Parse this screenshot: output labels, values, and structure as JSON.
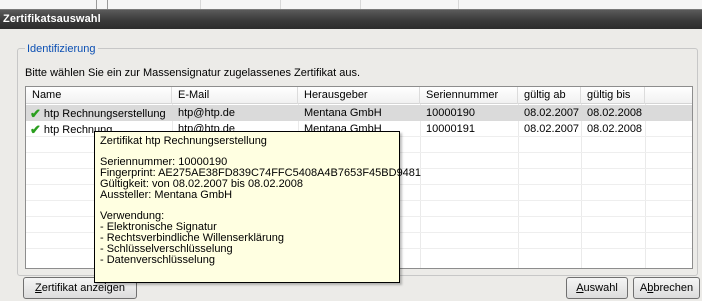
{
  "window": {
    "title": "Zertifikatsauswahl"
  },
  "group": {
    "legend": "Identifizierung"
  },
  "instruction": "Bitte wählen Sie ein zur Massensignatur zugelassenes Zertifikat aus.",
  "table": {
    "columns": [
      "Name",
      "E-Mail",
      "Herausgeber",
      "Seriennummer",
      "gültig ab",
      "gültig bis"
    ],
    "rows": [
      {
        "name": "htp Rechnungserstellung",
        "email": "htp@htp.de",
        "issuer": "Mentana GmbH",
        "serial": "10000190",
        "valid_from": "08.02.2007",
        "valid_to": "08.02.2008",
        "selected": true
      },
      {
        "name": "htp Rechnung",
        "email": "htp@htp.de",
        "issuer": "Mentana GmbH",
        "serial": "10000191",
        "valid_from": "08.02.2007",
        "valid_to": "08.02.2008",
        "selected": false
      }
    ]
  },
  "tooltip": {
    "title": "Zertifikat htp Rechnungserstellung",
    "serial": "Seriennummer: 10000190",
    "fingerprint": "Fingerprint: AE275AE38FD839C74FFC5408A4B7653F45BD9481",
    "validity": "Gültigkeit: von 08.02.2007 bis 08.02.2008",
    "issuer": "Aussteller: Mentana GmbH",
    "usage_title": "Verwendung:",
    "usage": [
      "- Elektronische Signatur",
      "- Rechtsverbindliche Willenserklärung",
      "- Schlüsselverschlüsselung",
      "- Datenverschlüsselung"
    ]
  },
  "buttons": {
    "show": {
      "pre": "",
      "key": "Z",
      "post": "ertifikat anzeigen"
    },
    "select": {
      "pre": "",
      "key": "A",
      "post": "uswahl"
    },
    "cancel": {
      "pre": "A",
      "key": "b",
      "post": "brechen"
    }
  },
  "colors": {
    "check": "#2a9e1e",
    "legend": "#0b4fb3",
    "tooltip_bg": "#ffffe1",
    "selected_row": "#dadada"
  },
  "icons": {
    "row_status": "checkmark-icon"
  }
}
